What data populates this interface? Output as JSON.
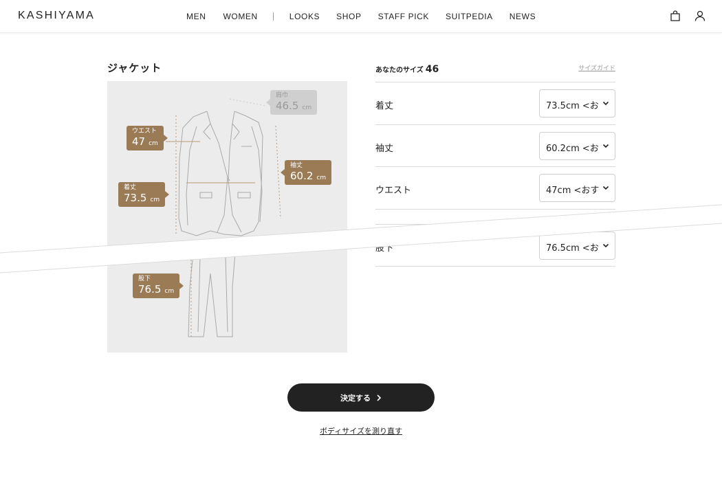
{
  "header": {
    "logo": "KASHIYAMA",
    "nav": [
      "MEN",
      "WOMEN",
      "LOOKS",
      "SHOP",
      "STAFF PICK",
      "SUITPEDIA",
      "NEWS"
    ],
    "icons": [
      "shopping-bag-icon",
      "user-icon"
    ]
  },
  "section": {
    "title": "ジャケット"
  },
  "figure": {
    "tags": {
      "shoulder": {
        "label": "肩巾",
        "value": "46.5",
        "unit": "cm"
      },
      "waist": {
        "label": "ウエスト",
        "value": "47",
        "unit": "cm"
      },
      "sleeve": {
        "label": "袖丈",
        "value": "60.2",
        "unit": "cm"
      },
      "length": {
        "label": "着丈",
        "value": "73.5",
        "unit": "cm"
      },
      "inseam": {
        "label": "股下",
        "value": "76.5",
        "unit": "cm"
      }
    },
    "colors": {
      "tag": "#9a7b56",
      "tag_inactive": "#cfcfcf",
      "background": "#ececec"
    }
  },
  "size_panel": {
    "your_size_label": "あなたのサイズ",
    "your_size_value": "46",
    "size_guide": "サイズガイド",
    "rows": [
      {
        "name": "着丈",
        "select_value": "73.5cm <お"
      },
      {
        "name": "袖丈",
        "select_value": "60.2cm <お"
      },
      {
        "name": "ウエスト",
        "select_value": "47cm <おす"
      },
      {
        "name": "",
        "select_value": ""
      },
      {
        "name": "股下",
        "select_value": "76.5cm <お"
      }
    ]
  },
  "actions": {
    "decide": "決定する",
    "remeasure": "ボディサイズを測り直す"
  }
}
